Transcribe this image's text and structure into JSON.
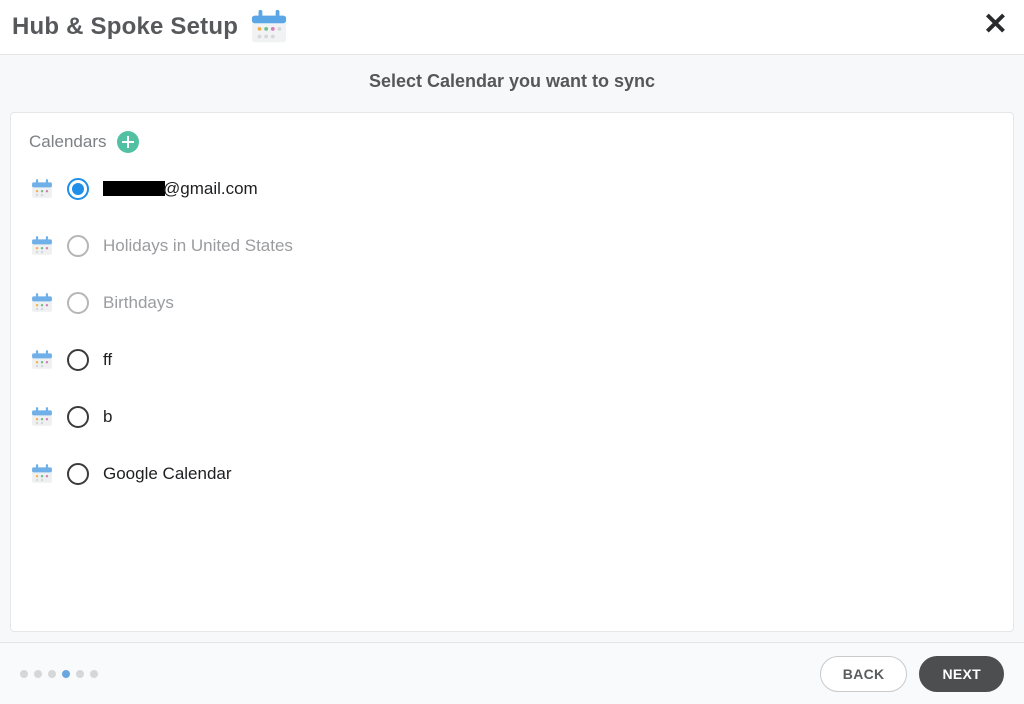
{
  "header": {
    "title": "Hub & Spoke Setup"
  },
  "subtitle": "Select Calendar you want to sync",
  "card": {
    "heading": "Calendars"
  },
  "calendars": [
    {
      "label_suffix": "@gmail.com",
      "redacted_prefix": true,
      "selected": true,
      "disabled": false
    },
    {
      "label": "Holidays in United States",
      "selected": false,
      "disabled": true
    },
    {
      "label": "Birthdays",
      "selected": false,
      "disabled": true
    },
    {
      "label": "ff",
      "selected": false,
      "disabled": false
    },
    {
      "label": "b",
      "selected": false,
      "disabled": false
    },
    {
      "label": "Google Calendar",
      "selected": false,
      "disabled": false
    }
  ],
  "progress": {
    "total_steps": 6,
    "current_step_index": 3
  },
  "buttons": {
    "back": "BACK",
    "next": "NEXT"
  },
  "colors": {
    "accent": "#1f8fe8",
    "plus_badge": "#52c1a3",
    "next_btn": "#4c4e50"
  }
}
